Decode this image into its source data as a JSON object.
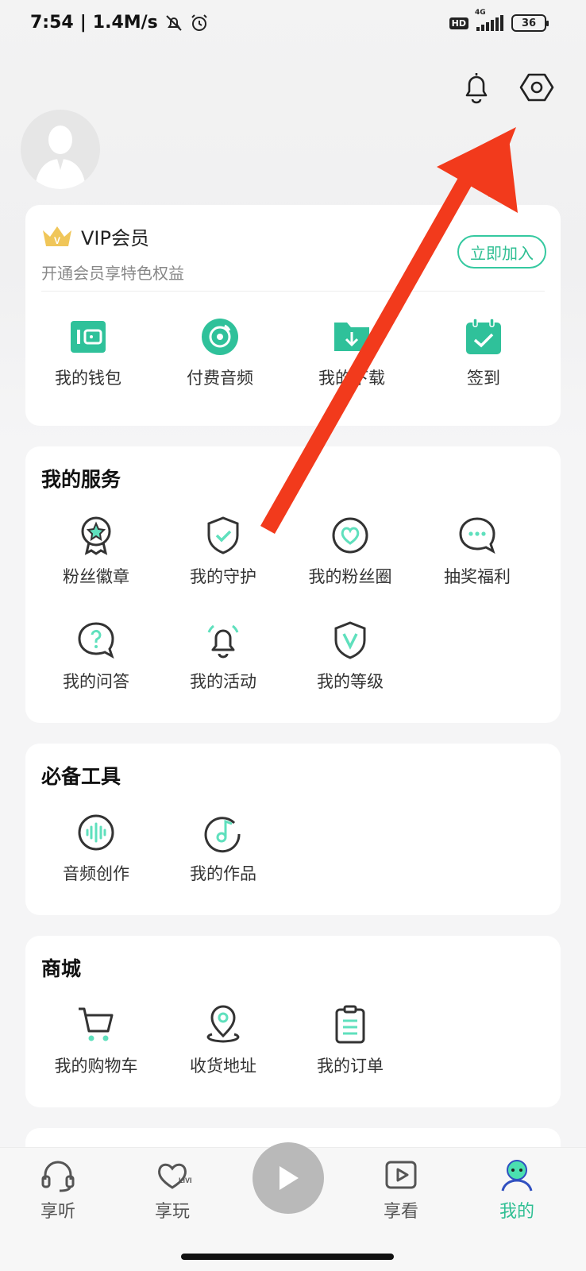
{
  "status_bar": {
    "time": "7:54",
    "net_speed": "1.4M/s",
    "hd": "HD",
    "network": "4G",
    "battery": "36"
  },
  "header": {
    "bell_icon": "bell-icon",
    "settings_icon": "hexagon-settings-icon"
  },
  "vip": {
    "title": "VIP会员",
    "subtitle": "开通会员享特色权益",
    "join_label": "立即加入",
    "items": [
      {
        "label": "我的钱包",
        "icon": "wallet-icon"
      },
      {
        "label": "付费音频",
        "icon": "disc-icon"
      },
      {
        "label": "我的下载",
        "icon": "download-folder-icon"
      },
      {
        "label": "签到",
        "icon": "calendar-check-icon"
      }
    ]
  },
  "services": {
    "title": "我的服务",
    "items": [
      {
        "label": "粉丝徽章",
        "icon": "badge-star-icon"
      },
      {
        "label": "我的守护",
        "icon": "shield-check-icon"
      },
      {
        "label": "我的粉丝圈",
        "icon": "heart-circle-icon"
      },
      {
        "label": "抽奖福利",
        "icon": "chat-dots-icon"
      },
      {
        "label": "我的问答",
        "icon": "question-bubble-icon"
      },
      {
        "label": "我的活动",
        "icon": "bell-ring-icon"
      },
      {
        "label": "我的等级",
        "icon": "v-shield-icon"
      }
    ]
  },
  "tools": {
    "title": "必备工具",
    "items": [
      {
        "label": "音频创作",
        "icon": "waveform-icon"
      },
      {
        "label": "我的作品",
        "icon": "music-note-icon"
      }
    ]
  },
  "mall": {
    "title": "商城",
    "items": [
      {
        "label": "我的购物车",
        "icon": "cart-icon"
      },
      {
        "label": "收货地址",
        "icon": "location-pin-icon"
      },
      {
        "label": "我的订单",
        "icon": "clipboard-icon"
      }
    ]
  },
  "bottom_nav": {
    "items": [
      {
        "label": "享听",
        "icon": "headphones-icon"
      },
      {
        "label": "享玩",
        "icon": "heart-live-icon"
      },
      {
        "label": "享看",
        "icon": "video-play-icon"
      },
      {
        "label": "我的",
        "icon": "user-icon"
      }
    ],
    "play_icon": "play-icon"
  },
  "colors": {
    "accent": "#2fbf93",
    "annotation_arrow": "#f23a1c"
  }
}
